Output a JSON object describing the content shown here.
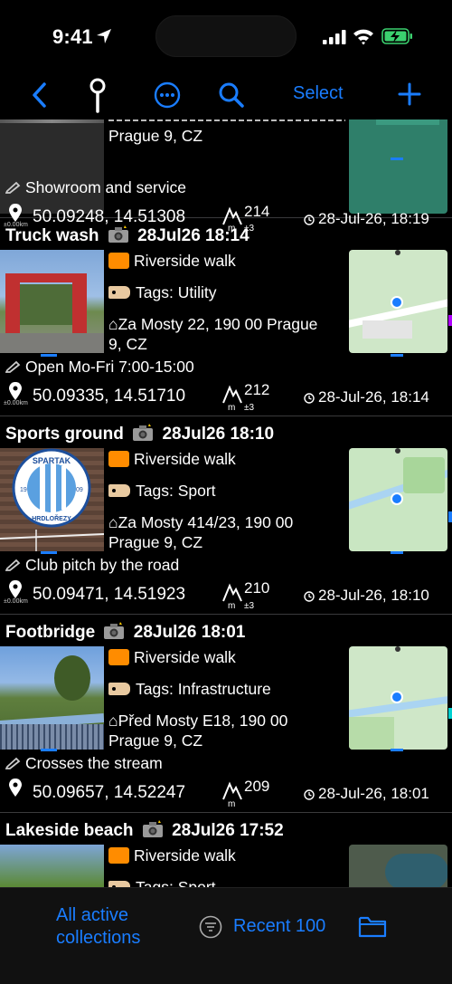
{
  "status": {
    "time": "9:41"
  },
  "toolbar": {
    "select_label": "Select"
  },
  "entries": [
    {
      "address_line2": "Prague 9, CZ",
      "note": "Showroom and service",
      "coords": "50.09248, 14.51308",
      "altitude": "214",
      "alt_unit": "m",
      "alt_acc": "±3",
      "accuracy": "±0.00km",
      "datetime": "28-Jul-26, 18:19"
    },
    {
      "name": "Truck wash",
      "stamp": "28Jul26 18:14",
      "collection": "Riverside walk",
      "tags": "Tags: Utility",
      "address_line1": "Za Mosty 22, 190 00 Prague",
      "address_line2": "9, CZ",
      "note": "Open Mo-Fri 7:00-15:00",
      "coords": "50.09335, 14.51710",
      "altitude": "212",
      "alt_unit": "m",
      "alt_acc": "±3",
      "accuracy": "±0.00km",
      "datetime": "28-Jul-26, 18:14"
    },
    {
      "name": "Sports ground",
      "stamp": "28Jul26 18:10",
      "collection": "Riverside walk",
      "tags": "Tags: Sport",
      "address_line1": "Za Mosty 414/23, 190 00",
      "address_line2": "Prague 9, CZ",
      "note": "Club pitch by the road",
      "coords": "50.09471, 14.51923",
      "altitude": "210",
      "alt_unit": "m",
      "alt_acc": "±3",
      "accuracy": "±0.00km",
      "datetime": "28-Jul-26, 18:10",
      "logo_top": "SPARTAK",
      "logo_bottom": "HRDLOŘEZY",
      "logo_left": "19",
      "logo_right": "09"
    },
    {
      "name": "Footbridge",
      "stamp": "28Jul26 18:01",
      "collection": "Riverside walk",
      "tags": "Tags: Infrastructure",
      "address_line1": "Před Mosty E18, 190 00",
      "address_line2": "Prague 9, CZ",
      "note": "Crosses the stream",
      "coords": "50.09657, 14.52247",
      "altitude": "209",
      "alt_unit": "m",
      "datetime": "28-Jul-26, 18:01"
    },
    {
      "name": "Lakeside beach",
      "stamp": "28Jul26 17:52",
      "collection": "Riverside walk",
      "tags": "Tags: Sport"
    }
  ],
  "bottom": {
    "collections_line1": "All active",
    "collections_line2": "collections",
    "filter_label": "Recent 100"
  },
  "colors": {
    "accent": "#1a7dff",
    "folder": "#ff8c00",
    "background": "#000000"
  }
}
